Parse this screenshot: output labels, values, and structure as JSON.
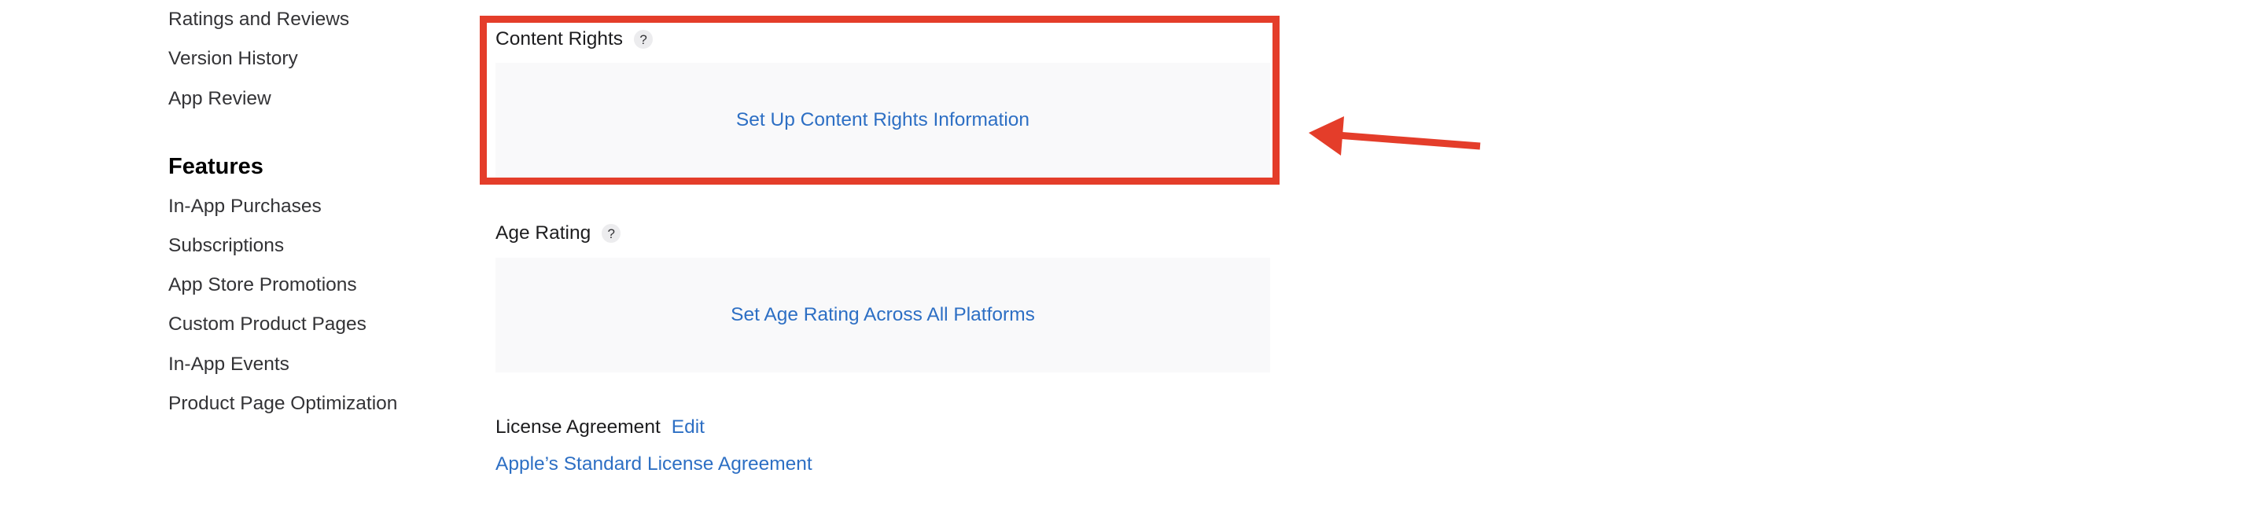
{
  "sidebar": {
    "items_top": [
      {
        "label": "Ratings and Reviews"
      },
      {
        "label": "Version History"
      },
      {
        "label": "App Review"
      }
    ],
    "features_heading": "Features",
    "features_items": [
      {
        "label": "In-App Purchases"
      },
      {
        "label": "Subscriptions"
      },
      {
        "label": "App Store Promotions"
      },
      {
        "label": "Custom Product Pages"
      },
      {
        "label": "In-App Events"
      },
      {
        "label": "Product Page Optimization"
      }
    ]
  },
  "main": {
    "content_rights": {
      "title": "Content Rights",
      "help": "?",
      "action": "Set Up Content Rights Information"
    },
    "age_rating": {
      "title": "Age Rating",
      "help": "?",
      "action": "Set Age Rating Across All Platforms"
    },
    "license": {
      "title": "License Agreement",
      "edit_label": "Edit",
      "link": "Apple’s Standard License Agreement"
    }
  },
  "annotation": {
    "color": "#e43d2a"
  },
  "colors": {
    "link": "#2d6fc4",
    "panel_background": "#f9f9fa"
  }
}
